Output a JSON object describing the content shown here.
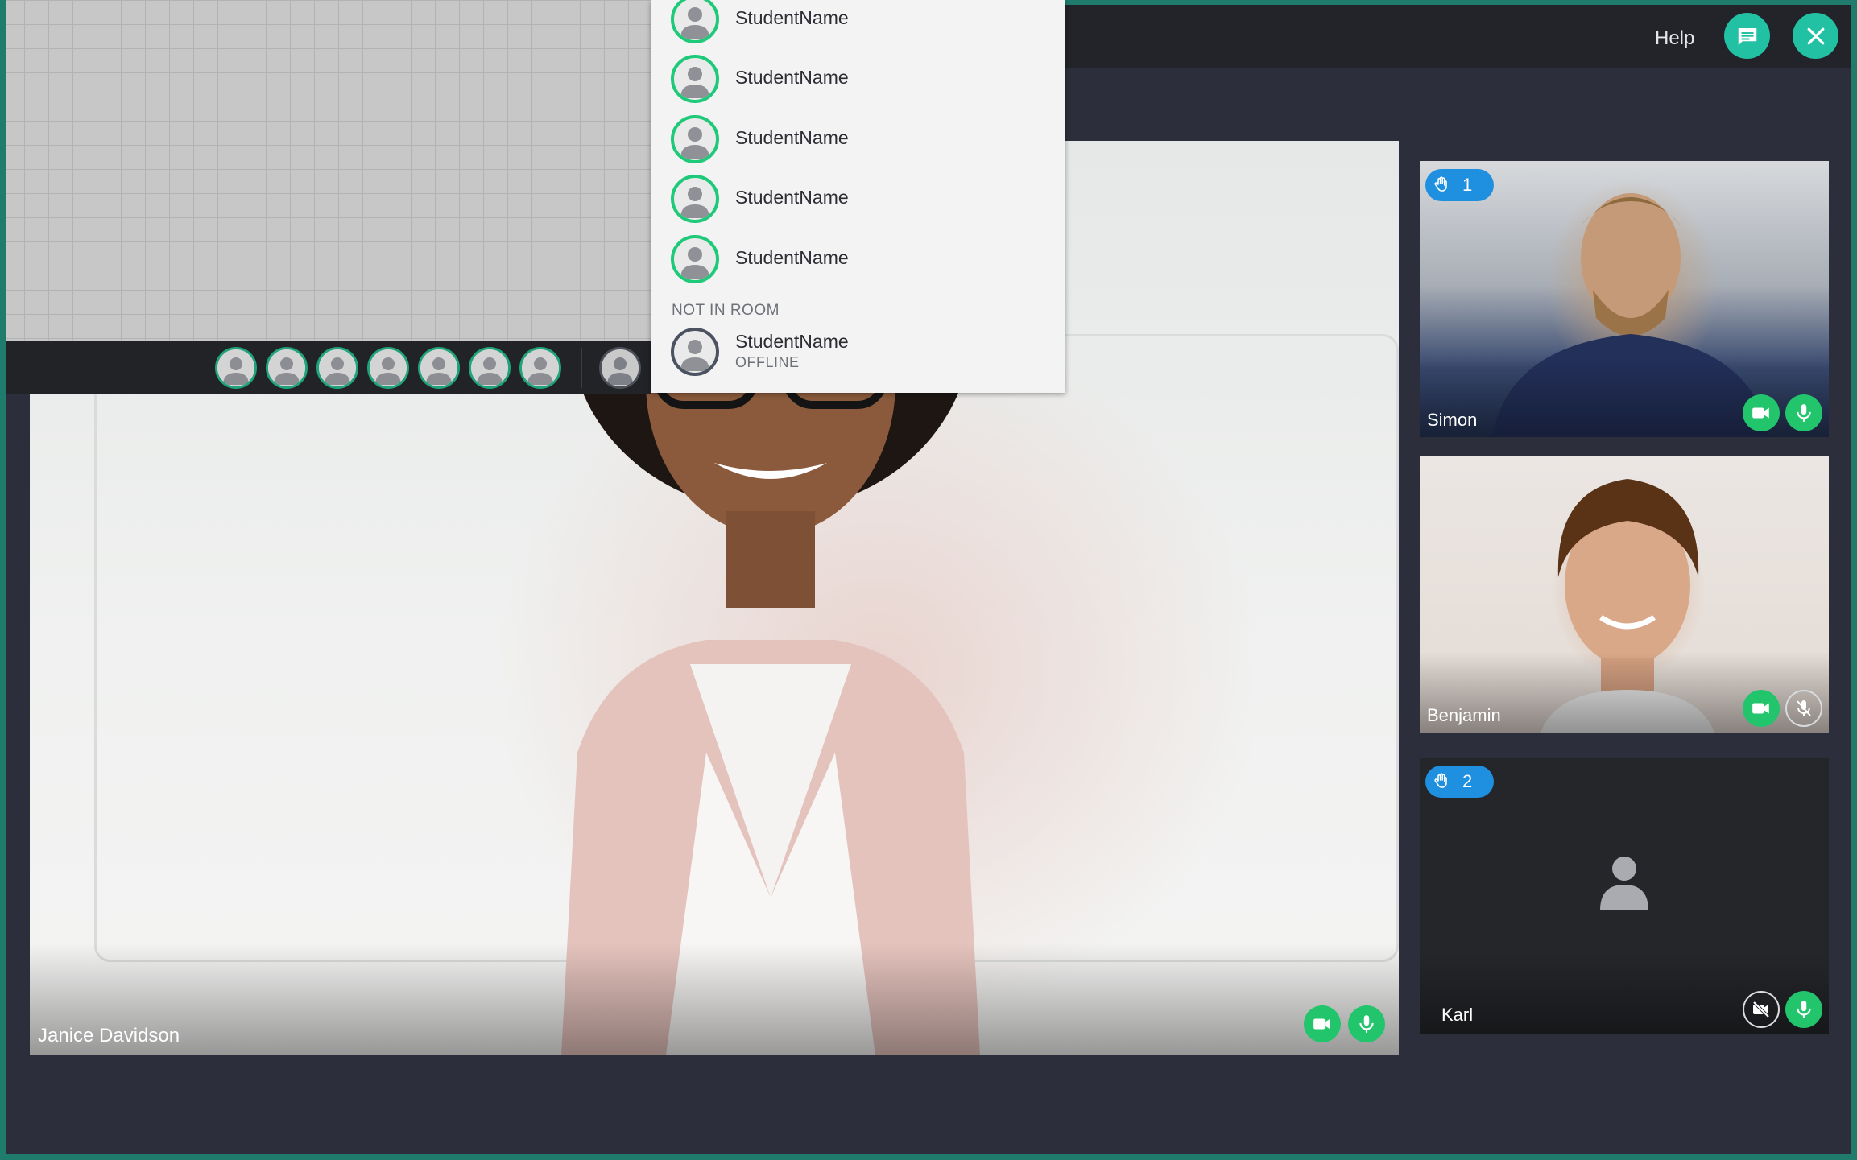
{
  "header": {
    "help_label": "Help",
    "chat_icon": "chat-icon",
    "close_icon": "close-icon",
    "accent_color": "#22c1a3"
  },
  "whiteboard": {
    "participant_bar": {
      "in_room_avatars": 7,
      "offline_avatars": 1
    }
  },
  "participants_dropdown": {
    "in_room": [
      {
        "name": "StudentName"
      },
      {
        "name": "StudentName"
      },
      {
        "name": "StudentName"
      },
      {
        "name": "StudentName"
      },
      {
        "name": "StudentName"
      }
    ],
    "section_label": "NOT IN ROOM",
    "not_in_room": [
      {
        "name": "StudentName",
        "status": "OFFLINE"
      }
    ]
  },
  "main_video": {
    "name": "Janice Davidson",
    "camera": "on",
    "mic": "on"
  },
  "side_tiles": [
    {
      "name": "Simon",
      "hand_raised": true,
      "hand_order": "1",
      "camera": "on",
      "mic": "on"
    },
    {
      "name": "Benjamin",
      "hand_raised": false,
      "camera": "on",
      "mic": "off"
    },
    {
      "name": "Karl",
      "hand_raised": true,
      "hand_order": "2",
      "camera": "off",
      "mic": "on"
    }
  ],
  "colors": {
    "online_ring": "#1ec979",
    "control_on": "#22c46c",
    "hand_badge": "#1f8fe0",
    "frame": "#1f7b6c"
  }
}
